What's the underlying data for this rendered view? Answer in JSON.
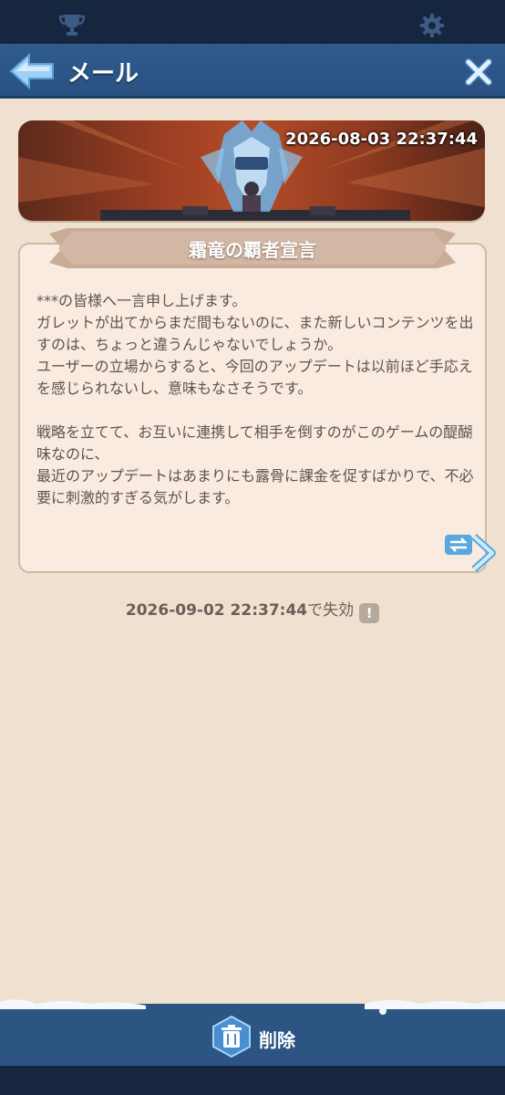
{
  "header": {
    "title": "メール"
  },
  "mail": {
    "sent_date": "2026-08-03 22:37:44",
    "title": "霜竜の覇者宣言",
    "body": "***の皆様へ一言申し上げます。\nガレットが出てからまだ間もないのに、また新しいコンテンツを出すのは、ちょっと違うんじゃないでしょうか。\nユーザーの立場からすると、今回のアップデートは以前ほど手応えを感じられないし、意味もなさそうです。\n\n戦略を立てて、お互いに連携して相手を倒すのがこのゲームの醍醐味なのに、\n最近のアップデートはあまりにも露骨に課金を促すばかりで、不必要に刺激的すぎる気がします。",
    "expiry_date": "2026-09-02 22:37:44",
    "expiry_suffix": "で失効",
    "warn_symbol": "!"
  },
  "footer": {
    "delete_label": "削除"
  },
  "icons": {
    "trophy": "trophy-icon",
    "settings": "gear-icon",
    "back": "back-arrow-icon",
    "close": "close-icon",
    "translate": "translate-icon",
    "delete": "trash-icon"
  },
  "colors": {
    "header_bg": "#2f5b8d",
    "top_strip": "#16263f",
    "panel_bg": "#efe0d0",
    "card_bg": "#f9ebe0",
    "ribbon": "#c9ab98",
    "body_text": "#5f534b",
    "accent_blue": "#4a8ed1"
  }
}
